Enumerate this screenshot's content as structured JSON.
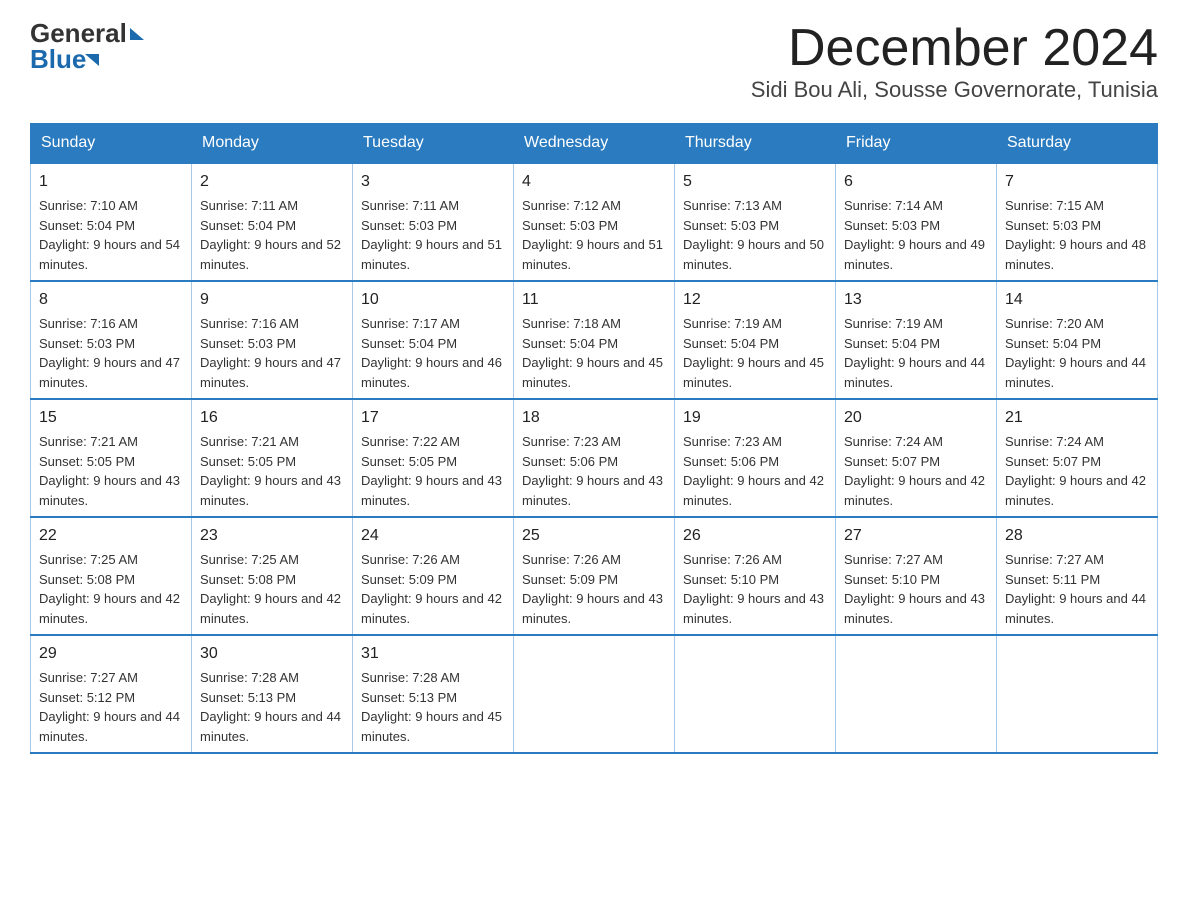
{
  "header": {
    "logo_general": "General",
    "logo_blue": "Blue",
    "month_title": "December 2024",
    "location": "Sidi Bou Ali, Sousse Governorate, Tunisia"
  },
  "weekdays": [
    "Sunday",
    "Monday",
    "Tuesday",
    "Wednesday",
    "Thursday",
    "Friday",
    "Saturday"
  ],
  "weeks": [
    [
      {
        "day": "1",
        "sunrise": "Sunrise: 7:10 AM",
        "sunset": "Sunset: 5:04 PM",
        "daylight": "Daylight: 9 hours and 54 minutes."
      },
      {
        "day": "2",
        "sunrise": "Sunrise: 7:11 AM",
        "sunset": "Sunset: 5:04 PM",
        "daylight": "Daylight: 9 hours and 52 minutes."
      },
      {
        "day": "3",
        "sunrise": "Sunrise: 7:11 AM",
        "sunset": "Sunset: 5:03 PM",
        "daylight": "Daylight: 9 hours and 51 minutes."
      },
      {
        "day": "4",
        "sunrise": "Sunrise: 7:12 AM",
        "sunset": "Sunset: 5:03 PM",
        "daylight": "Daylight: 9 hours and 51 minutes."
      },
      {
        "day": "5",
        "sunrise": "Sunrise: 7:13 AM",
        "sunset": "Sunset: 5:03 PM",
        "daylight": "Daylight: 9 hours and 50 minutes."
      },
      {
        "day": "6",
        "sunrise": "Sunrise: 7:14 AM",
        "sunset": "Sunset: 5:03 PM",
        "daylight": "Daylight: 9 hours and 49 minutes."
      },
      {
        "day": "7",
        "sunrise": "Sunrise: 7:15 AM",
        "sunset": "Sunset: 5:03 PM",
        "daylight": "Daylight: 9 hours and 48 minutes."
      }
    ],
    [
      {
        "day": "8",
        "sunrise": "Sunrise: 7:16 AM",
        "sunset": "Sunset: 5:03 PM",
        "daylight": "Daylight: 9 hours and 47 minutes."
      },
      {
        "day": "9",
        "sunrise": "Sunrise: 7:16 AM",
        "sunset": "Sunset: 5:03 PM",
        "daylight": "Daylight: 9 hours and 47 minutes."
      },
      {
        "day": "10",
        "sunrise": "Sunrise: 7:17 AM",
        "sunset": "Sunset: 5:04 PM",
        "daylight": "Daylight: 9 hours and 46 minutes."
      },
      {
        "day": "11",
        "sunrise": "Sunrise: 7:18 AM",
        "sunset": "Sunset: 5:04 PM",
        "daylight": "Daylight: 9 hours and 45 minutes."
      },
      {
        "day": "12",
        "sunrise": "Sunrise: 7:19 AM",
        "sunset": "Sunset: 5:04 PM",
        "daylight": "Daylight: 9 hours and 45 minutes."
      },
      {
        "day": "13",
        "sunrise": "Sunrise: 7:19 AM",
        "sunset": "Sunset: 5:04 PM",
        "daylight": "Daylight: 9 hours and 44 minutes."
      },
      {
        "day": "14",
        "sunrise": "Sunrise: 7:20 AM",
        "sunset": "Sunset: 5:04 PM",
        "daylight": "Daylight: 9 hours and 44 minutes."
      }
    ],
    [
      {
        "day": "15",
        "sunrise": "Sunrise: 7:21 AM",
        "sunset": "Sunset: 5:05 PM",
        "daylight": "Daylight: 9 hours and 43 minutes."
      },
      {
        "day": "16",
        "sunrise": "Sunrise: 7:21 AM",
        "sunset": "Sunset: 5:05 PM",
        "daylight": "Daylight: 9 hours and 43 minutes."
      },
      {
        "day": "17",
        "sunrise": "Sunrise: 7:22 AM",
        "sunset": "Sunset: 5:05 PM",
        "daylight": "Daylight: 9 hours and 43 minutes."
      },
      {
        "day": "18",
        "sunrise": "Sunrise: 7:23 AM",
        "sunset": "Sunset: 5:06 PM",
        "daylight": "Daylight: 9 hours and 43 minutes."
      },
      {
        "day": "19",
        "sunrise": "Sunrise: 7:23 AM",
        "sunset": "Sunset: 5:06 PM",
        "daylight": "Daylight: 9 hours and 42 minutes."
      },
      {
        "day": "20",
        "sunrise": "Sunrise: 7:24 AM",
        "sunset": "Sunset: 5:07 PM",
        "daylight": "Daylight: 9 hours and 42 minutes."
      },
      {
        "day": "21",
        "sunrise": "Sunrise: 7:24 AM",
        "sunset": "Sunset: 5:07 PM",
        "daylight": "Daylight: 9 hours and 42 minutes."
      }
    ],
    [
      {
        "day": "22",
        "sunrise": "Sunrise: 7:25 AM",
        "sunset": "Sunset: 5:08 PM",
        "daylight": "Daylight: 9 hours and 42 minutes."
      },
      {
        "day": "23",
        "sunrise": "Sunrise: 7:25 AM",
        "sunset": "Sunset: 5:08 PM",
        "daylight": "Daylight: 9 hours and 42 minutes."
      },
      {
        "day": "24",
        "sunrise": "Sunrise: 7:26 AM",
        "sunset": "Sunset: 5:09 PM",
        "daylight": "Daylight: 9 hours and 42 minutes."
      },
      {
        "day": "25",
        "sunrise": "Sunrise: 7:26 AM",
        "sunset": "Sunset: 5:09 PM",
        "daylight": "Daylight: 9 hours and 43 minutes."
      },
      {
        "day": "26",
        "sunrise": "Sunrise: 7:26 AM",
        "sunset": "Sunset: 5:10 PM",
        "daylight": "Daylight: 9 hours and 43 minutes."
      },
      {
        "day": "27",
        "sunrise": "Sunrise: 7:27 AM",
        "sunset": "Sunset: 5:10 PM",
        "daylight": "Daylight: 9 hours and 43 minutes."
      },
      {
        "day": "28",
        "sunrise": "Sunrise: 7:27 AM",
        "sunset": "Sunset: 5:11 PM",
        "daylight": "Daylight: 9 hours and 44 minutes."
      }
    ],
    [
      {
        "day": "29",
        "sunrise": "Sunrise: 7:27 AM",
        "sunset": "Sunset: 5:12 PM",
        "daylight": "Daylight: 9 hours and 44 minutes."
      },
      {
        "day": "30",
        "sunrise": "Sunrise: 7:28 AM",
        "sunset": "Sunset: 5:13 PM",
        "daylight": "Daylight: 9 hours and 44 minutes."
      },
      {
        "day": "31",
        "sunrise": "Sunrise: 7:28 AM",
        "sunset": "Sunset: 5:13 PM",
        "daylight": "Daylight: 9 hours and 45 minutes."
      },
      null,
      null,
      null,
      null
    ]
  ]
}
